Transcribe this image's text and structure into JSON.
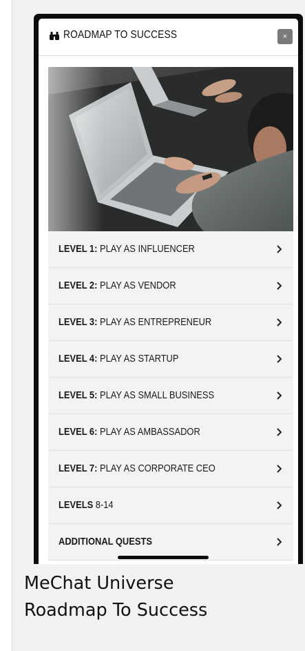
{
  "modal": {
    "title": "ROADMAP TO SUCCESS",
    "title_icon": "binoculars-icon",
    "close_label": "×"
  },
  "hero": {
    "description_icon": "hero-image"
  },
  "levels": [
    {
      "prefix": "LEVEL 1:",
      "text": " PLAY AS INFLUENCER"
    },
    {
      "prefix": "LEVEL 2:",
      "text": " PLAY AS VENDOR"
    },
    {
      "prefix": "LEVEL 3:",
      "text": " PLAY AS ENTREPRENEUR"
    },
    {
      "prefix": "LEVEL 4:",
      "text": " PLAY AS STARTUP"
    },
    {
      "prefix": "LEVEL 5:",
      "text": " PLAY AS SMALL BUSINESS"
    },
    {
      "prefix": "LEVEL 6:",
      "text": " PLAY AS AMBASSADOR"
    },
    {
      "prefix": "LEVEL 7:",
      "text": " PLAY AS CORPORATE CEO"
    },
    {
      "prefix": "LEVELS",
      "text": " 8-14"
    },
    {
      "prefix": "ADDITIONAL QUESTS",
      "text": ""
    }
  ],
  "caption": {
    "line1": "MeChat Universe",
    "line2": "Roadmap To Success"
  }
}
